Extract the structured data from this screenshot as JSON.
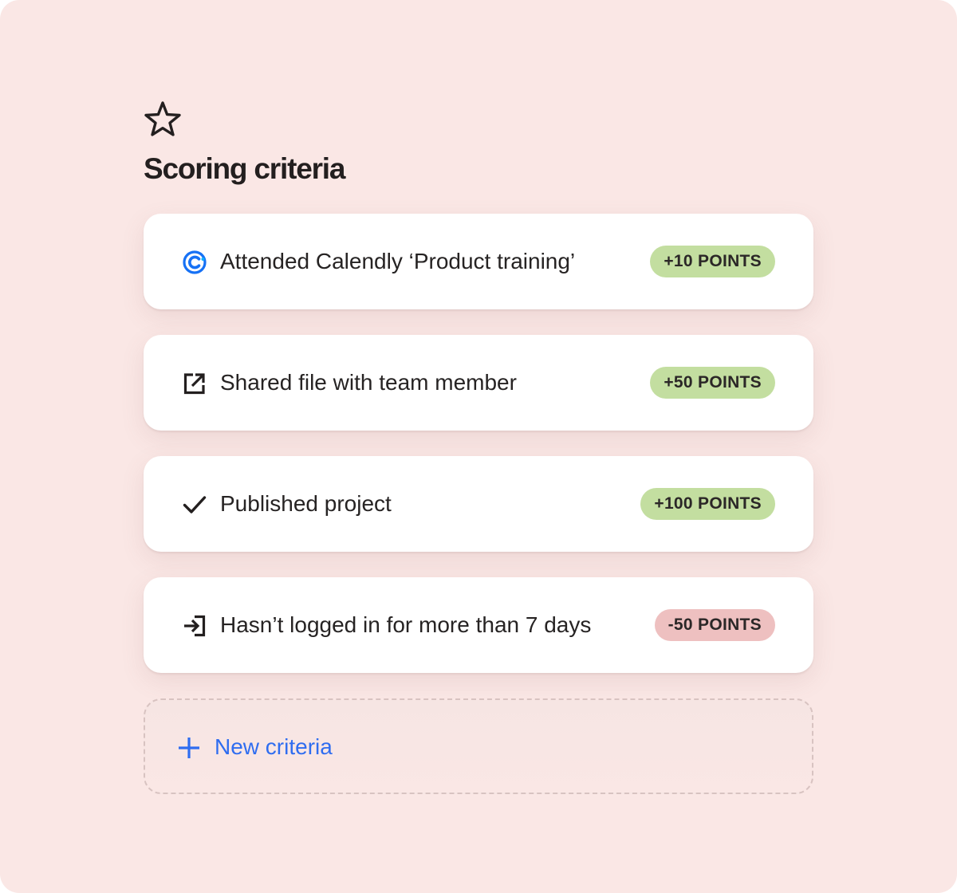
{
  "section": {
    "icon": "star-icon",
    "title": "Scoring criteria"
  },
  "colors": {
    "background": "#fae7e5",
    "positive_badge": "#c3dea0",
    "negative_badge": "#eec0c0",
    "accent": "#2f6df0",
    "calendly_brand": "#1671f5"
  },
  "criteria": [
    {
      "icon": "calendly-logo-icon",
      "label": "Attended Calendly ‘Product training’",
      "points": "+10 POINTS",
      "tone": "positive"
    },
    {
      "icon": "share-external-icon",
      "label": "Shared file with team member",
      "points": "+50 POINTS",
      "tone": "positive"
    },
    {
      "icon": "checkmark-icon",
      "label": "Published project",
      "points": "+100 POINTS",
      "tone": "positive"
    },
    {
      "icon": "login-icon",
      "label": "Hasn’t logged in for more than 7 days",
      "points": "-50 POINTS",
      "tone": "negative"
    }
  ],
  "add_button": {
    "icon": "plus-icon",
    "label": "New criteria"
  }
}
